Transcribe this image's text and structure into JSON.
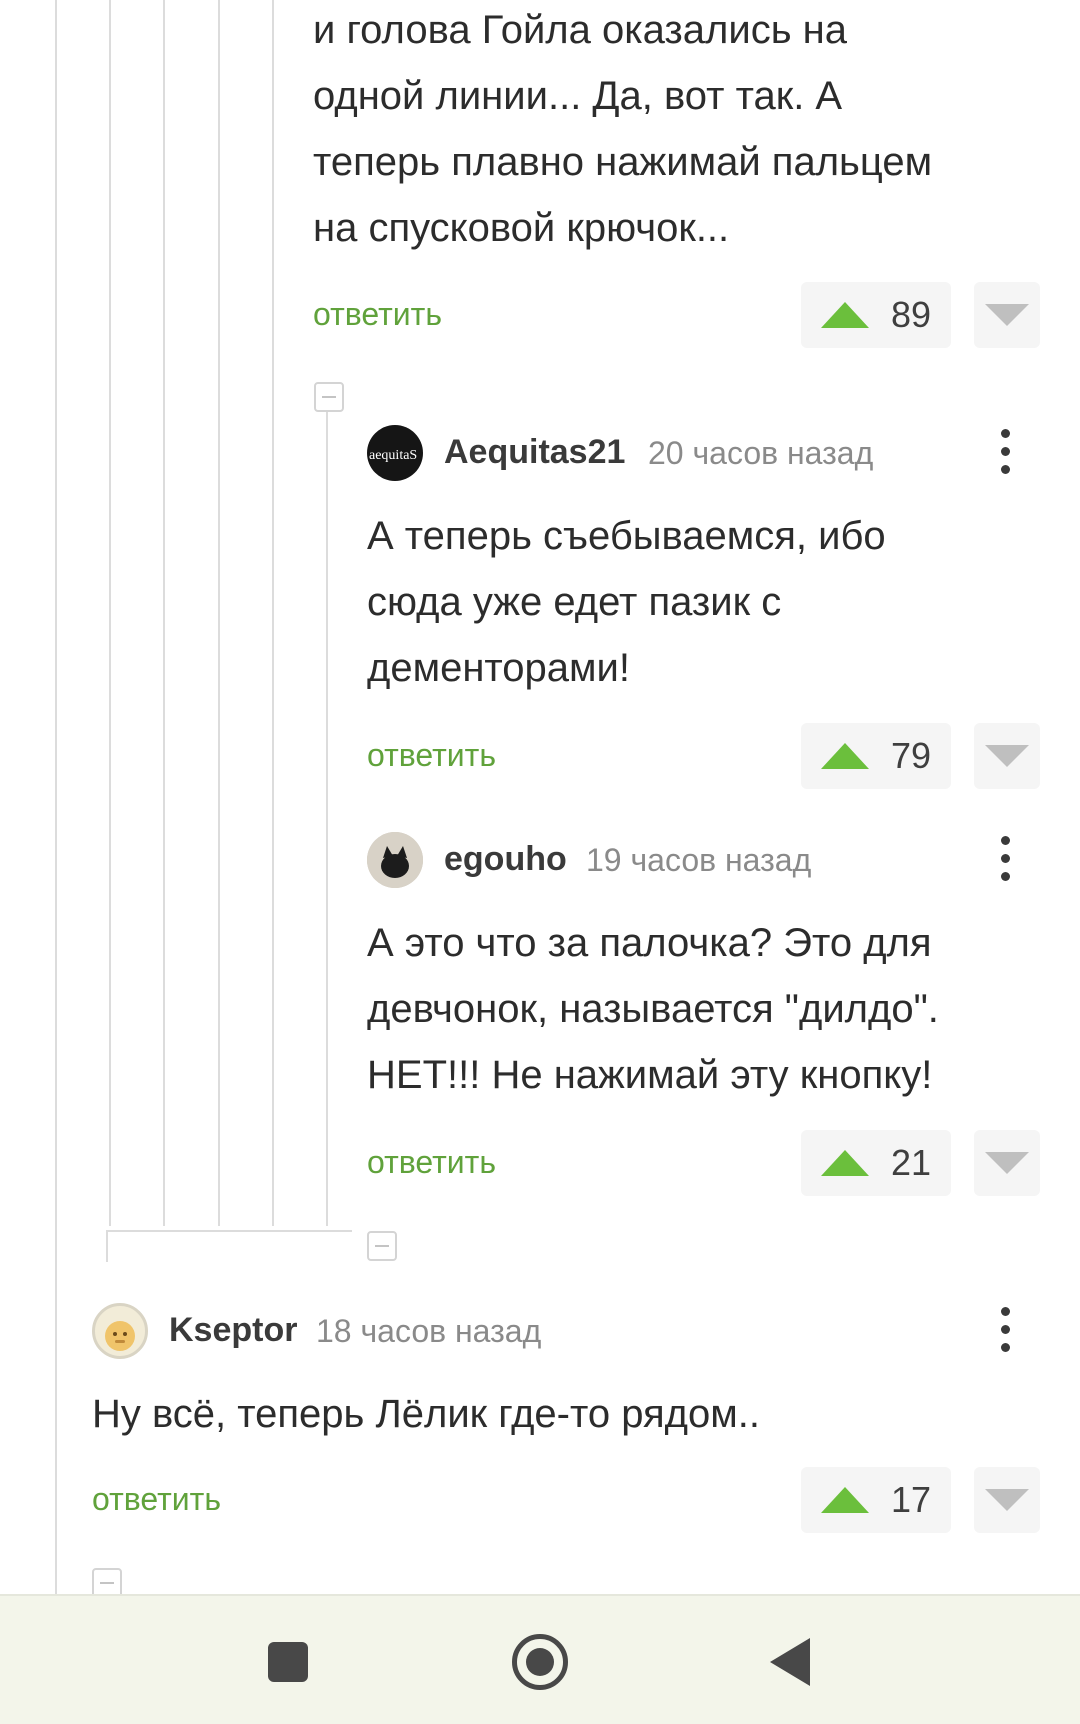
{
  "comment_top": {
    "text": "и голова Гойла оказались на\nодной линии... Да, вот так. А\nтеперь плавно нажимай пальцем\nна спусковой крючок...",
    "reply_label": "ответить",
    "votes": "89"
  },
  "comment_aequitas": {
    "author": "Aequitas21",
    "time": "20 часов назад",
    "avatar_text": "aequitaS",
    "text": "А теперь съебываемся, ибо\nсюда уже едет пазик с\nдементорами!",
    "reply_label": "ответить",
    "votes": "79"
  },
  "comment_egouho": {
    "author": "egouho",
    "time": "19 часов назад",
    "text": "А это что за палочка? Это для\nдевчонок, называется \"дилдо\".\nНЕТ!!! Не нажимай эту кнопку!",
    "reply_label": "ответить",
    "votes": "21"
  },
  "comment_kseptor": {
    "author": "Kseptor",
    "time": "18 часов назад",
    "text": "Ну всё, теперь Лёлик где-то рядом..",
    "reply_label": "ответить",
    "votes": "17"
  },
  "colors": {
    "accent_green": "#60a23b",
    "upvote_green": "#6bbf3c",
    "thread_line": "#dcdcdc"
  },
  "icons": [
    "upvote-icon",
    "downvote-icon",
    "more-icon",
    "collapse-icon",
    "nav-recents-icon",
    "nav-home-icon",
    "nav-back-icon"
  ]
}
